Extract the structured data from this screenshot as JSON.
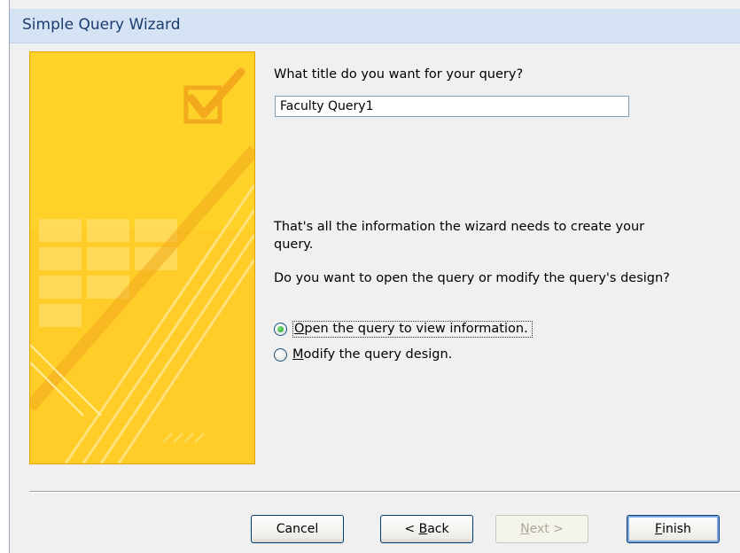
{
  "window": {
    "title": "Simple Query Wizard"
  },
  "form": {
    "title_prompt": "What title do you want for your query?",
    "title_value": "Faculty Query1",
    "info_line1": "That's all the information the wizard needs to create your",
    "info_line2": "query.",
    "question": "Do you want to open the query or modify the query's design?"
  },
  "options": [
    {
      "key_letter": "O",
      "label_rest": "pen the query to view information.",
      "checked": true
    },
    {
      "key_letter": "M",
      "label_rest": "odify the query design.",
      "checked": false
    }
  ],
  "buttons": {
    "cancel": "Cancel",
    "back_prefix": "< ",
    "back_key": "B",
    "back_rest": "ack",
    "next_key": "N",
    "next_rest": "ext >",
    "finish_key": "F",
    "finish_rest": "inish"
  },
  "colors": {
    "title_bar": "#d5e3f4",
    "illustration": "#ffd22a",
    "radio_selected": "#1f9f1f"
  }
}
